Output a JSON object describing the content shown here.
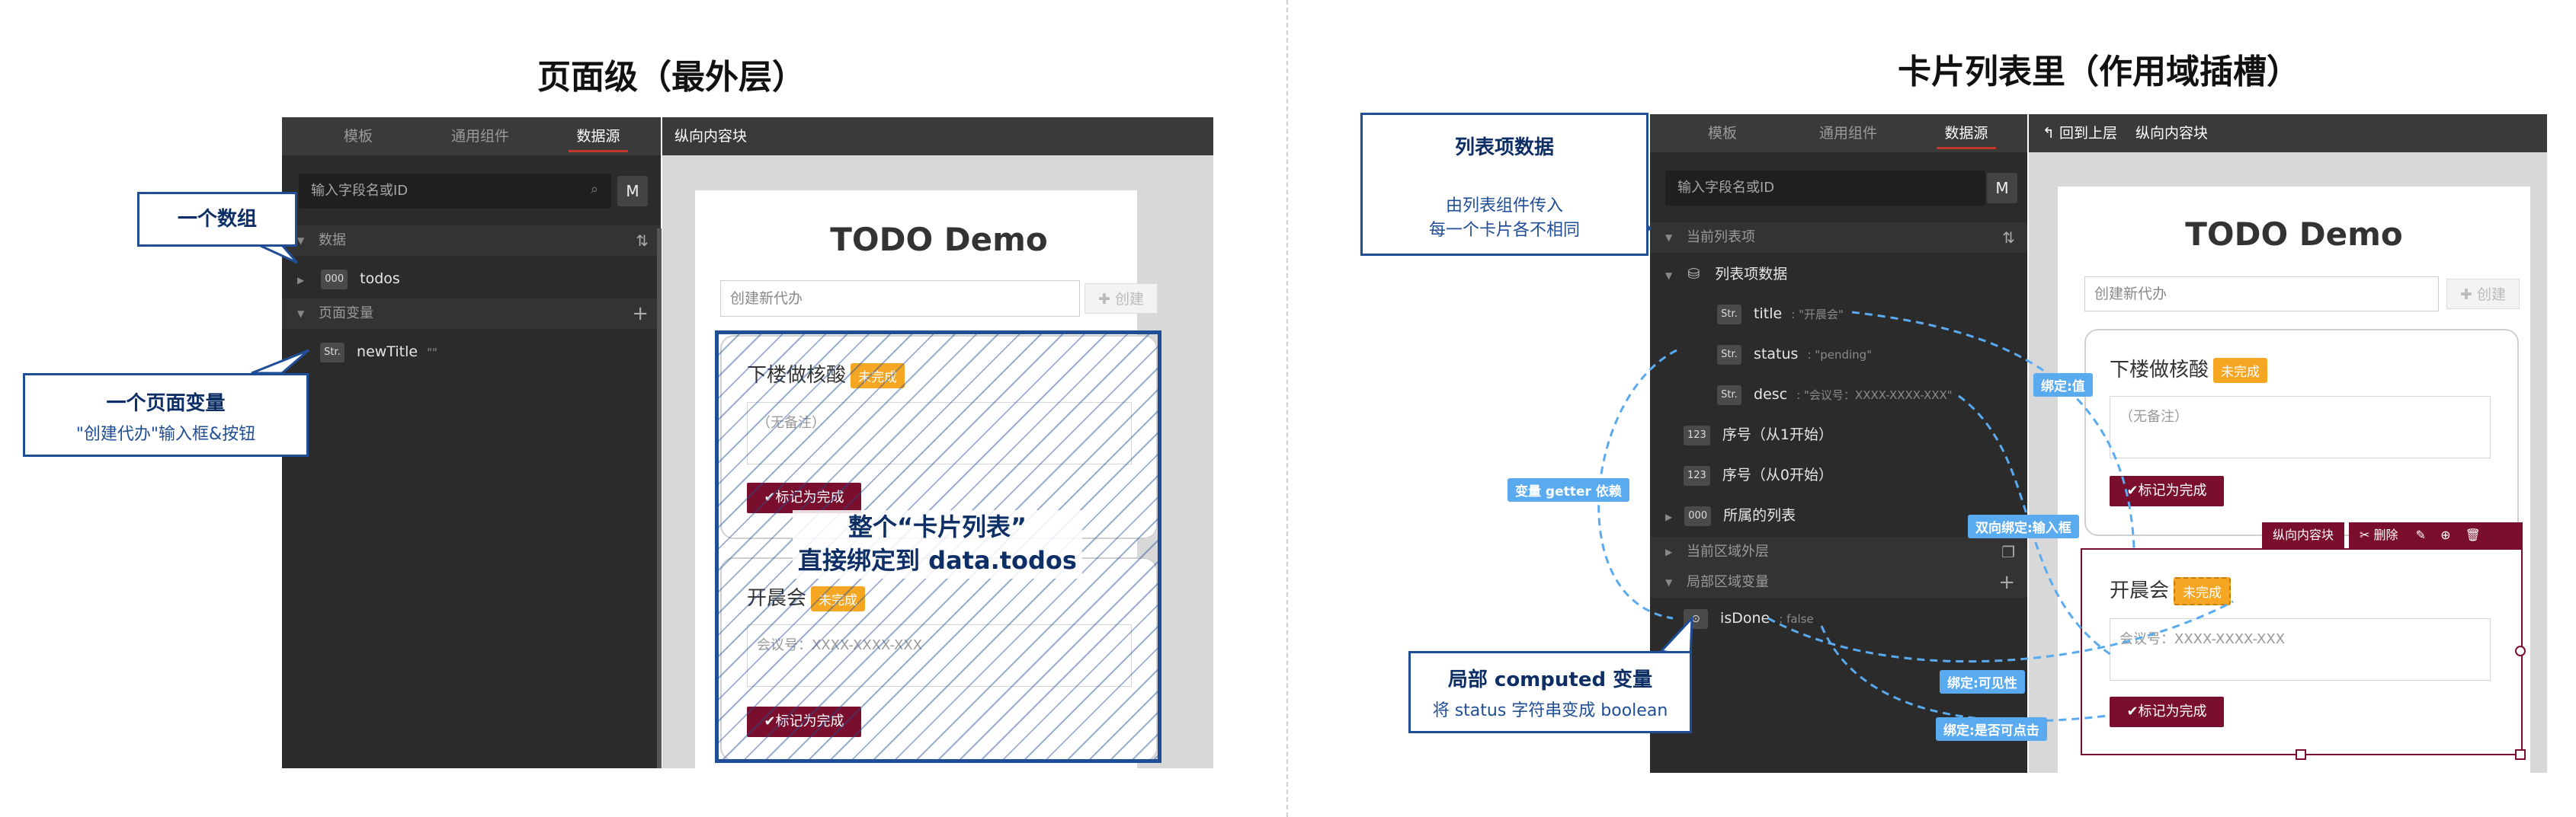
{
  "left": {
    "heading": "页面级（最外层）",
    "tabs": [
      "模板",
      "通用组件",
      "数据源"
    ],
    "header_right": "纵向内容块",
    "search_placeholder": "输入字段名或ID",
    "m_button": "M",
    "sections": {
      "data": "数据",
      "page_vars": "页面变量"
    },
    "rows": {
      "todos": {
        "tag": "000",
        "name": "todos"
      },
      "newTitle": {
        "tag": "Str.",
        "name": "newTitle",
        "hint": "\"\""
      }
    },
    "callouts": {
      "array": "一个数组",
      "page_var_title": "一个页面变量",
      "page_var_sub": "\"创建代办\"输入框&按钮"
    },
    "big_label": [
      "整个“卡片列表”",
      "直接绑定到 data.todos"
    ]
  },
  "right": {
    "heading": "卡片列表里（作用域插槽）",
    "tabs": [
      "模板",
      "通用组件",
      "数据源"
    ],
    "header_back": "回到上层",
    "header_right": "纵向内容块",
    "search_placeholder": "输入字段名或ID",
    "m_button": "M",
    "sections": {
      "current_item": "当前列表项",
      "outer_scope": "当前区域外层",
      "local_vars": "局部区域变量"
    },
    "rows": {
      "item_data": "列表项数据",
      "title": {
        "tag": "Str.",
        "name": "title",
        "hint": ": \"开晨会\""
      },
      "status": {
        "tag": "Str.",
        "name": "status",
        "hint": ": \"pending\""
      },
      "desc": {
        "tag": "Str.",
        "name": "desc",
        "hint": ": \"会议号：XXXX-XXXX-XXX\""
      },
      "index1": {
        "tag": "123",
        "name": "序号（从1开始）"
      },
      "index0": {
        "tag": "123",
        "name": "序号（从0开始）"
      },
      "parent_list": {
        "tag": "000",
        "name": "所属的列表"
      },
      "isDone": {
        "tag": "",
        "name": "isDone",
        "hint": ": false"
      }
    },
    "callouts": {
      "item_title": "列表项数据",
      "item_sub1": "由列表组件传入",
      "item_sub2": "每一个卡片各不相同",
      "computed_title": "局部 computed 变量",
      "computed_sub": "将 status 字符串变成 boolean"
    },
    "pills": {
      "bind_value": "绑定:值",
      "getter": "变量 getter 依赖",
      "two_way": "双向绑定:输入框",
      "visible": "绑定:可见性",
      "clickable": "绑定:是否可点击"
    },
    "selection_toolbar": {
      "label": "纵向内容块",
      "delete": "删除"
    }
  },
  "demo": {
    "title": "TODO Demo",
    "input_placeholder": "创建新代办",
    "create_button": "创建",
    "cards": [
      {
        "title": "下楼做核酸",
        "badge": "未完成",
        "note": "（无备注）",
        "button": "标记为完成"
      },
      {
        "title": "开晨会",
        "badge": "未完成",
        "note": "会议号：XXXX-XXXX-XXX",
        "button": "标记为完成"
      }
    ]
  },
  "colors": {
    "brand_dark_blue": "#1f4e96",
    "accent_red": "#7a0f2d",
    "badge_orange": "#f5a623",
    "pill_blue": "#5aaaf0"
  },
  "icons": [
    "sync-icon",
    "plus-icon",
    "database-icon",
    "toggle-icon",
    "copy-icon",
    "back-arrow-icon",
    "check-icon",
    "scissors-icon",
    "edit-icon",
    "zoom-icon",
    "trash-icon",
    "search-icon"
  ]
}
